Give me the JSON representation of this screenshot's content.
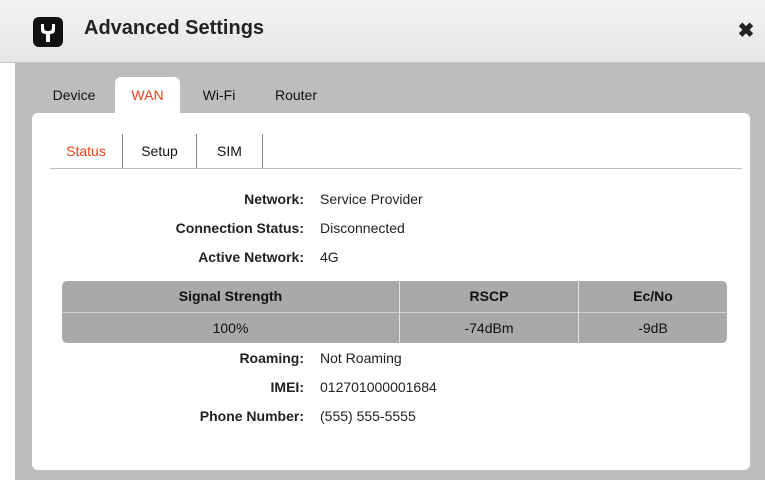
{
  "dialog": {
    "title": "Advanced Settings",
    "close_symbol": "✖"
  },
  "main_tabs": [
    {
      "label": "Device"
    },
    {
      "label": "WAN"
    },
    {
      "label": "Wi-Fi"
    },
    {
      "label": "Router"
    }
  ],
  "sub_tabs": [
    {
      "label": "Status"
    },
    {
      "label": "Setup"
    },
    {
      "label": "SIM"
    }
  ],
  "status": {
    "network": {
      "label": "Network:",
      "value": "Service Provider"
    },
    "connection": {
      "label": "Connection Status:",
      "value": "Disconnected"
    },
    "active_network": {
      "label": "Active Network:",
      "value": "4G"
    },
    "roaming": {
      "label": "Roaming:",
      "value": "Not Roaming"
    },
    "imei": {
      "label": "IMEI:",
      "value": "012701000001684"
    },
    "phone": {
      "label": "Phone Number:",
      "value": "(555) 555-5555"
    }
  },
  "signal_table": {
    "headers": [
      "Signal Strength",
      "RSCP",
      "Ec/No"
    ],
    "values": [
      "100%",
      "-74dBm",
      "-9dB"
    ]
  },
  "colors": {
    "accent": "#e8411b",
    "table_bg": "#a9a9a9",
    "body_bg": "#bdbdbd"
  },
  "icons": {
    "title": "tool-icon",
    "close": "close-icon"
  }
}
